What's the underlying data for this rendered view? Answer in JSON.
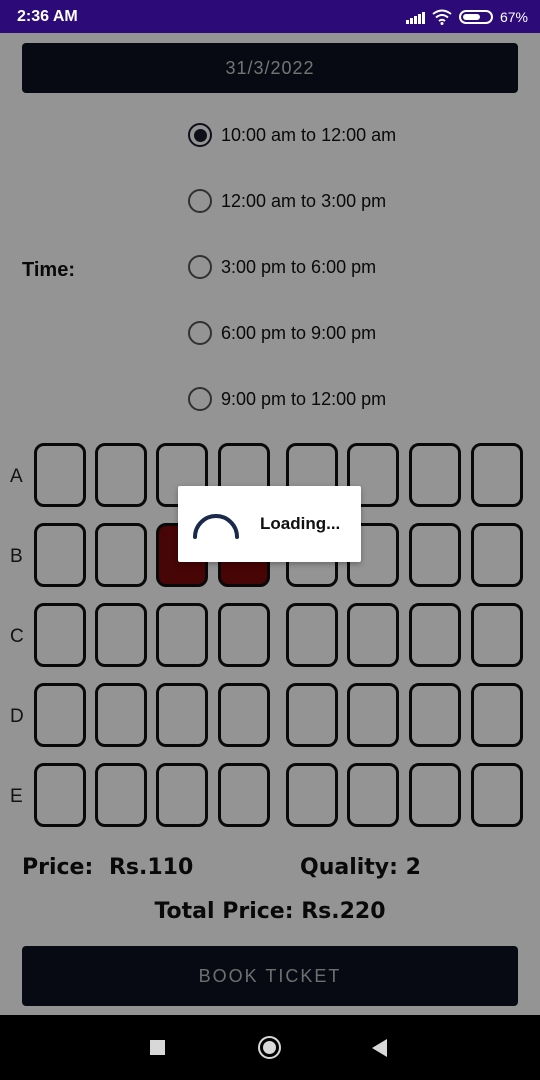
{
  "status_bar": {
    "time": "2:36 AM",
    "battery": "67%"
  },
  "date_button": {
    "label": "31/3/2022"
  },
  "time_section": {
    "label": "Time:",
    "options": [
      {
        "label": "10:00 am to 12:00 am",
        "selected": true
      },
      {
        "label": "12:00 am to 3:00 pm",
        "selected": false
      },
      {
        "label": "3:00 pm to 6:00 pm",
        "selected": false
      },
      {
        "label": "6:00 pm to 9:00 pm",
        "selected": false
      },
      {
        "label": "9:00 pm to 12:00 pm",
        "selected": false
      }
    ]
  },
  "seats": {
    "rows": [
      "A",
      "B",
      "C",
      "D",
      "E"
    ],
    "seats_per_row": 8,
    "selected": [
      [
        1,
        2
      ],
      [
        1,
        3
      ]
    ],
    "selected_color": "#7a0a0a"
  },
  "summary": {
    "price_label": "Price:",
    "price_value": "Rs.110",
    "quantity_label": "Quality:",
    "quantity_value": "2",
    "total_label": "Total Price:",
    "total_value": "Rs.220"
  },
  "book_button": {
    "label": "BOOK TICKET"
  },
  "loading_dialog": {
    "text": "Loading..."
  },
  "colors": {
    "accent_dark": "#0d1220",
    "status_bar": "#2c0a78",
    "selected_seat": "#7a0a0a"
  },
  "nav_bar": {
    "icons": [
      "recents-square-icon",
      "home-circle-icon",
      "back-triangle-icon"
    ]
  }
}
